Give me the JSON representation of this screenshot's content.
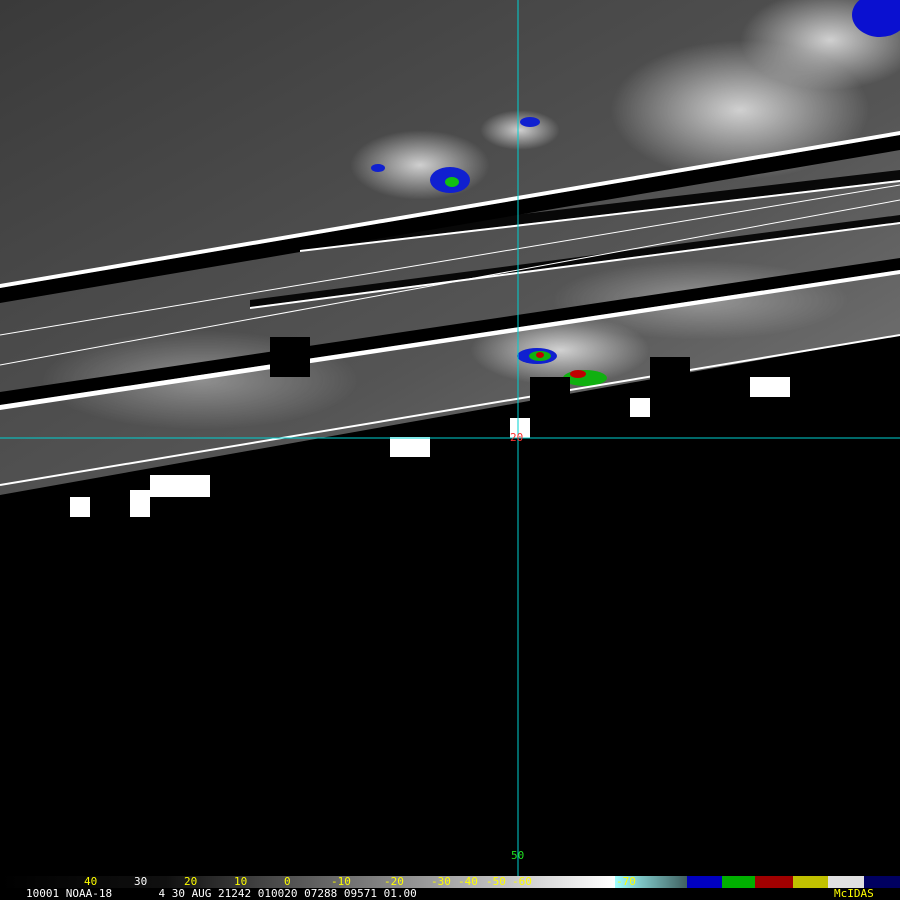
{
  "crosshair": {
    "lat_label": "20",
    "lon_label": "50",
    "color": "#00d0d0",
    "lat_label_color": "#ff3030",
    "lon_label_color": "#20e020"
  },
  "colorbar": {
    "tick_labels": [
      "40",
      "30",
      "20",
      "10",
      "0",
      "-10",
      "-20",
      "-30",
      "-40",
      "-50",
      "-60",
      "-70"
    ],
    "tick_colors": [
      "#ffff00",
      "#ffffff",
      "#ffff00",
      "#ffff00",
      "#ffff00",
      "#ffff00",
      "#ffff00",
      "#ffff00",
      "#ffff00",
      "#ffff00",
      "#ffff00",
      "#ffff00"
    ]
  },
  "footer": {
    "info": "10001 NOAA-18       4 30 AUG 21242 010020 07288 09571 01.00",
    "brand": "McIDAS",
    "text_color": "#ffffff",
    "brand_color": "#ffff00"
  }
}
